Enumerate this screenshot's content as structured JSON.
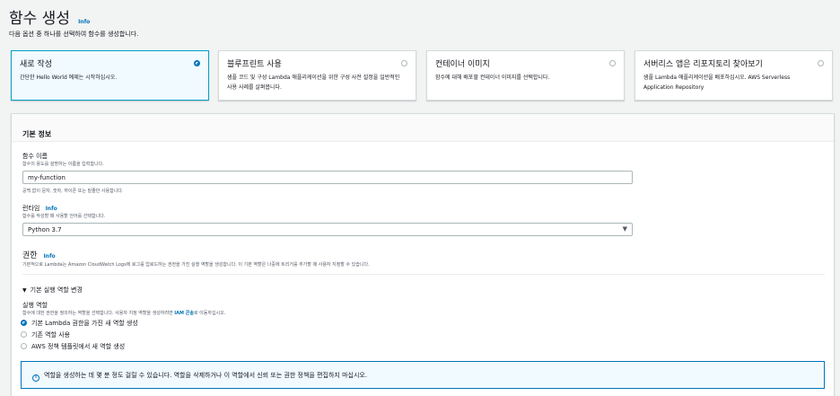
{
  "header": {
    "title": "함수 생성",
    "info": "Info",
    "description": "다음 옵션 중 하나를 선택하여 함수를 생성합니다."
  },
  "options": [
    {
      "title": "새로 작성",
      "desc": "간단한 Hello World 예제는 시작하십시오.",
      "selected": true
    },
    {
      "title": "블루프린트 사용",
      "desc": "샘플 코드 및 구성 Lambda 애플리케이션을 위한 구성 사전 설정을 일반적인 사용 사례를 살펴봅니다.",
      "selected": false
    },
    {
      "title": "컨테이너 이미지",
      "desc": "함수에 대해 배포할 컨테이너 이미지를 선택합니다.",
      "selected": false
    },
    {
      "title": "서버리스 앱은 리포지토리 찾아보기",
      "desc": "샘플 Lambda 애플리케이션을 배포하십시오. AWS Serverless Application Repository",
      "selected": false
    }
  ],
  "basic": {
    "section_title": "기본 정보",
    "fn_name_label": "함수 이름",
    "fn_name_help": "함수의 용도를 설명하는 이름을 입력합니다.",
    "fn_name_value": "my-function",
    "fn_name_constraint": "공백 없이 문자, 숫자, 하이픈 또는 밑줄만 사용합니다.",
    "runtime_label": "런타임",
    "runtime_info": "Info",
    "runtime_help": "함수를 작성할 때 사용할 언어를 선택합니다.",
    "runtime_value": "Python 3.7",
    "perm_title": "권한",
    "perm_info": "Info",
    "perm_desc": "기본적으로 Lambda는 Amazon CloudWatch Logs에 로그를 업로드하는 권한을 가진 실행 역할을 생성합니다. 이 기본 역할은 나중에 트리거를 추가할 때 사용자 지정할 수 있습니다.",
    "expand_label": "기본 실행 역할 변경",
    "role_label": "실행 역할",
    "role_help_pre": "함수에 대한 권한을 정의하는 역할을 선택합니다. 사용자 지정 역할을 생성하려면",
    "role_help_link": "IAM 콘솔",
    "role_help_post": "로 이동하십시오.",
    "role_options": [
      {
        "label": "기본 Lambda 권한을 가진 새 역할 생성",
        "selected": true
      },
      {
        "label": "기존 역할 사용",
        "selected": false
      },
      {
        "label": "AWS 정책 템플릿에서 새 역할 생성",
        "selected": false
      }
    ],
    "alert": "역할을 생성하는 데 몇 분 정도 걸릴 수 있습니다. 역할을 삭제하거나 이 역할에서 신뢰 또는 권한 정책을 편집하지 마십시오."
  },
  "colors": {
    "accent": "#0073bb",
    "selected_border": "#00a1c9",
    "background": "#f2f3f3"
  }
}
